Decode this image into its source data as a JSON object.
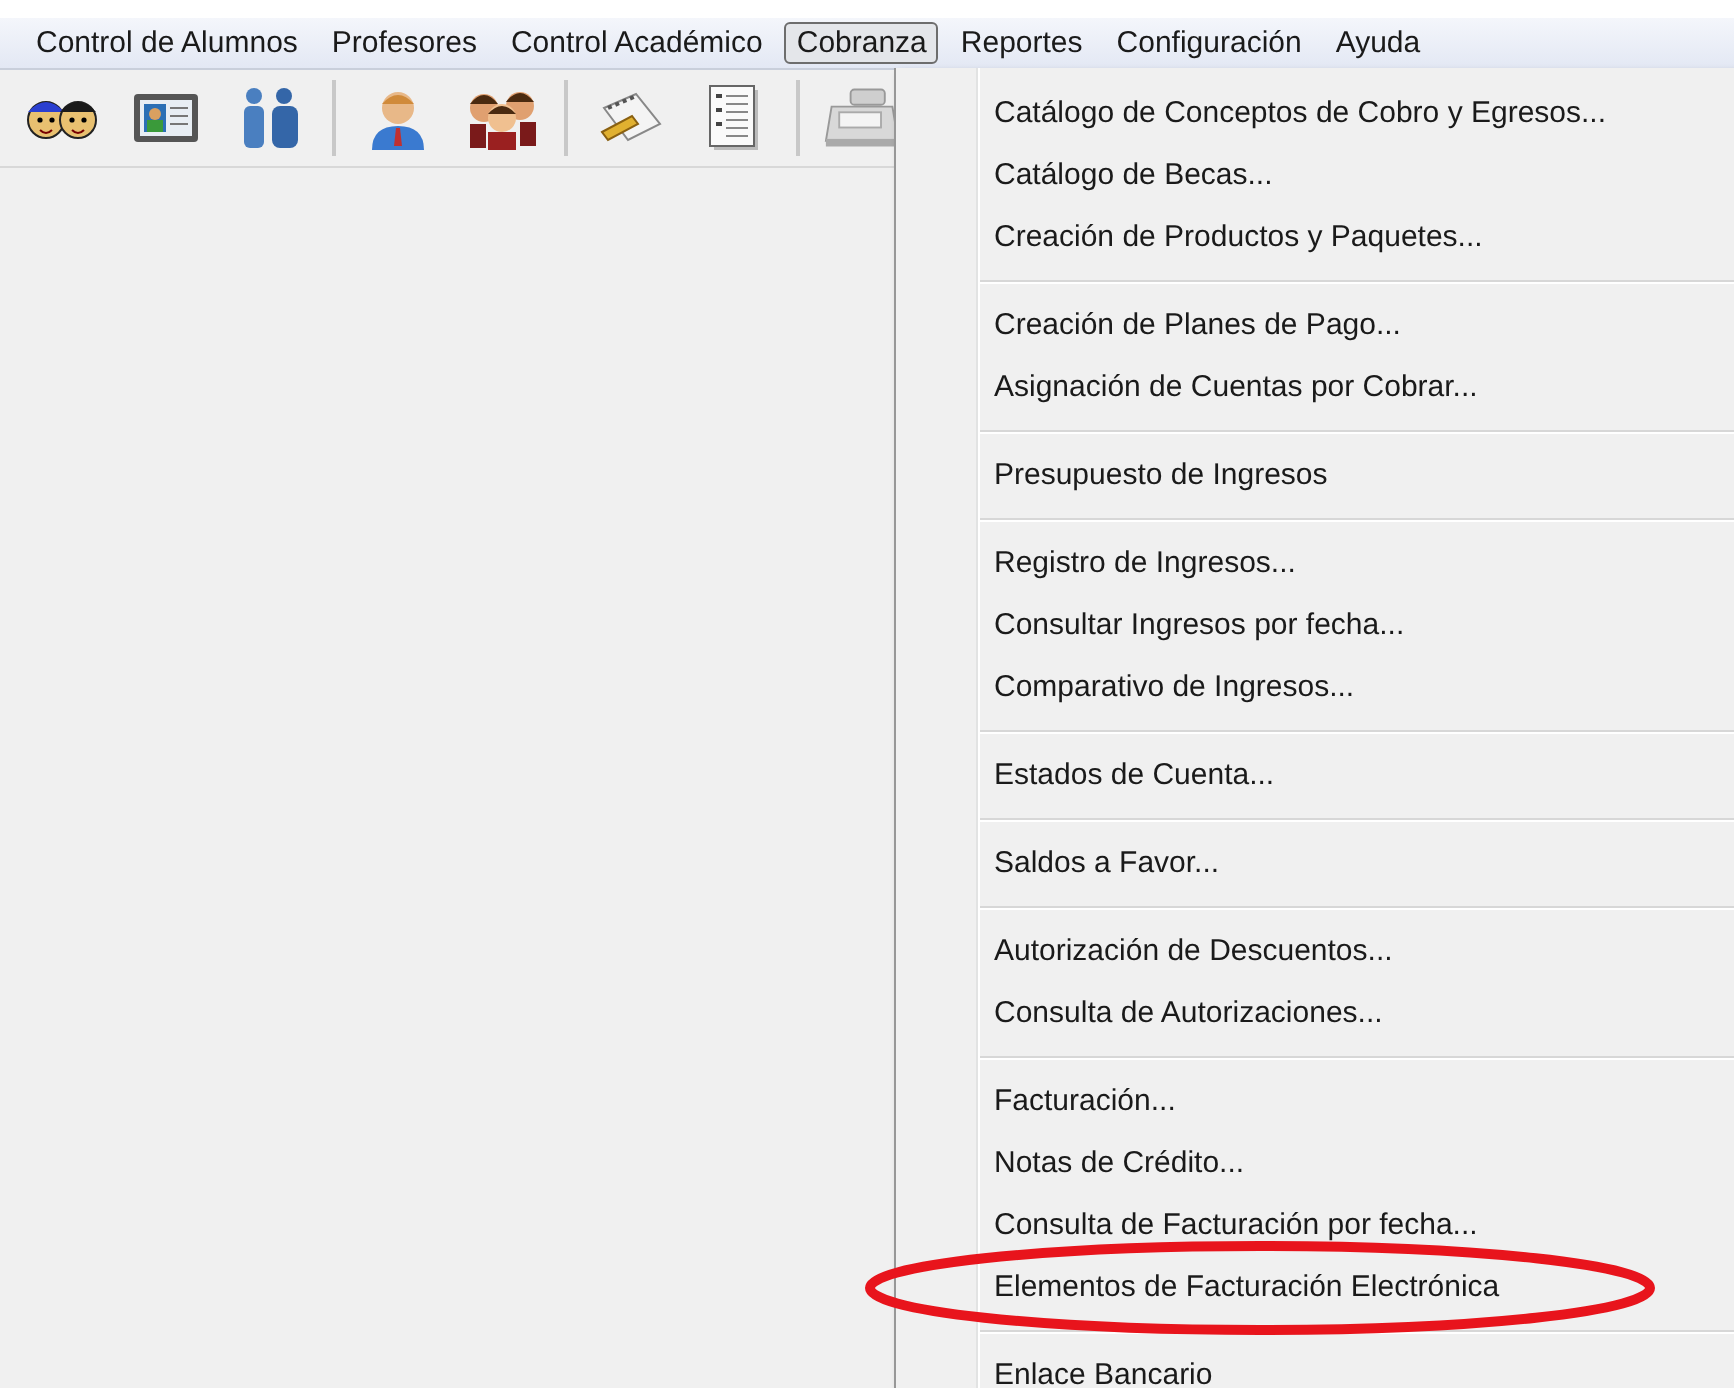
{
  "menu_bar": [
    {
      "label": "Control de Alumnos",
      "selected": false
    },
    {
      "label": "Profesores",
      "selected": false
    },
    {
      "label": "Control Académico",
      "selected": false
    },
    {
      "label": "Cobranza",
      "selected": true
    },
    {
      "label": "Reportes",
      "selected": false
    },
    {
      "label": "Configuración",
      "selected": false
    },
    {
      "label": "Ayuda",
      "selected": false
    }
  ],
  "toolbar": [
    [
      {
        "kind": "students"
      },
      {
        "kind": "id-card"
      },
      {
        "kind": "people"
      }
    ],
    [
      {
        "kind": "teacher"
      },
      {
        "kind": "group"
      }
    ],
    [
      {
        "kind": "notepad"
      },
      {
        "kind": "document"
      }
    ],
    [
      {
        "kind": "cash-register"
      }
    ]
  ],
  "dropdown_menu": [
    [
      {
        "label": "Catálogo de Conceptos de Cobro y Egresos...",
        "circled": false
      },
      {
        "label": "Catálogo de Becas...",
        "circled": false
      },
      {
        "label": "Creación de Productos y Paquetes...",
        "circled": false
      }
    ],
    [
      {
        "label": "Creación de Planes de Pago...",
        "circled": false
      },
      {
        "label": "Asignación de Cuentas por Cobrar...",
        "circled": false
      }
    ],
    [
      {
        "label": "Presupuesto de Ingresos",
        "circled": false
      }
    ],
    [
      {
        "label": "Registro de Ingresos...",
        "circled": false
      },
      {
        "label": "Consultar Ingresos por fecha...",
        "circled": false
      },
      {
        "label": "Comparativo de Ingresos...",
        "circled": false
      }
    ],
    [
      {
        "label": "Estados de Cuenta...",
        "circled": false
      }
    ],
    [
      {
        "label": "Saldos a Favor...",
        "circled": false
      }
    ],
    [
      {
        "label": "Autorización de Descuentos...",
        "circled": false
      },
      {
        "label": "Consulta de Autorizaciones...",
        "circled": false
      }
    ],
    [
      {
        "label": "Facturación...",
        "circled": false
      },
      {
        "label": "Notas de Crédito...",
        "circled": false
      },
      {
        "label": "Consulta de Facturación por fecha...",
        "circled": false
      },
      {
        "label": "Elementos de Facturación Electrónica",
        "circled": true
      }
    ],
    [
      {
        "label": "Enlace Bancario",
        "circled": false
      }
    ]
  ]
}
